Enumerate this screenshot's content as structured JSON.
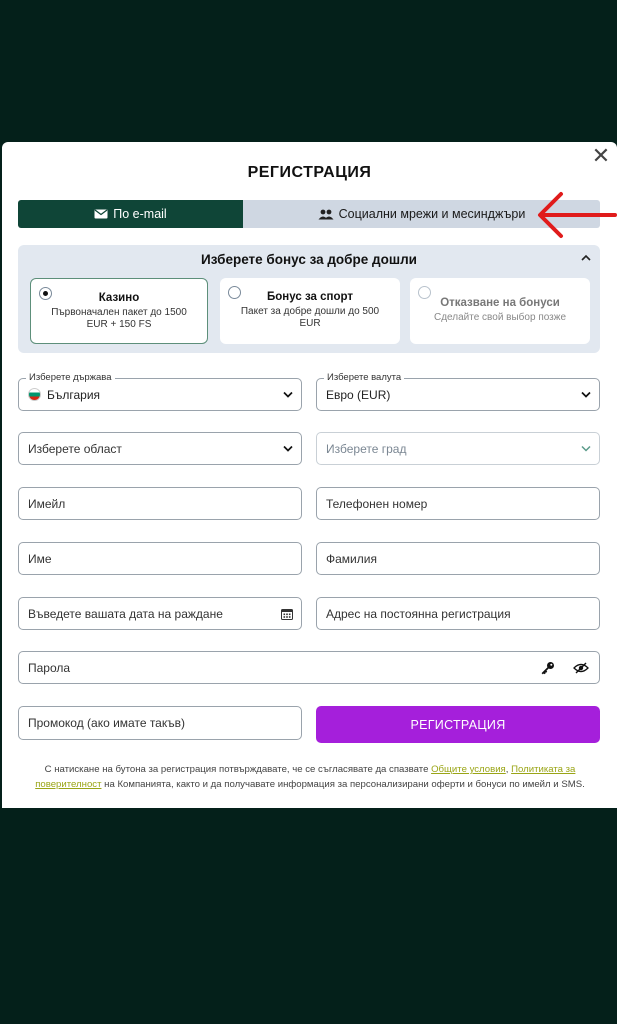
{
  "modal": {
    "title": "РЕГИСТРАЦИЯ",
    "close_symbol": "✕"
  },
  "tabs": [
    {
      "label": "По e-mail",
      "icon": "envelope-icon",
      "active": true
    },
    {
      "label": "Социални мрежи и месинджъри",
      "icon": "users-icon",
      "active": false
    }
  ],
  "bonus": {
    "heading": "Изберете бонус за добре дошли",
    "options": [
      {
        "title": "Казино",
        "desc": "Първоначален пакет до 1500 EUR + 150 FS",
        "selected": true
      },
      {
        "title": "Бонус за спорт",
        "desc": "Пакет за добре дошли до 500 EUR",
        "selected": false
      },
      {
        "title": "Отказване на бонуси",
        "desc": "Сделайте свой выбор позже",
        "selected": false
      }
    ]
  },
  "form": {
    "country": {
      "legend": "Изберете държава",
      "value": "България"
    },
    "currency": {
      "legend": "Изберете валута",
      "value": "Евро (EUR)"
    },
    "region": {
      "placeholder": "Изберете област"
    },
    "city": {
      "placeholder": "Изберете град"
    },
    "email": {
      "placeholder": "Имейл"
    },
    "phone": {
      "placeholder": "Телефонен номер"
    },
    "first_name": {
      "placeholder": "Име"
    },
    "last_name": {
      "placeholder": "Фамилия"
    },
    "birthdate": {
      "placeholder": "Въведете вашата дата на раждане"
    },
    "address": {
      "placeholder": "Адрес на постоянна регистрация"
    },
    "password": {
      "placeholder": "Парола"
    },
    "promo": {
      "placeholder": "Промокод (ако имате такъв)"
    },
    "submit_label": "РЕГИСТРАЦИЯ"
  },
  "terms": {
    "text_1": "С натискане на бутона за регистрация потвърждавате, че се съгласявате да спазвате ",
    "link_1": "Общите условия",
    "text_2": ", ",
    "link_2": "Политиката за поверителност",
    "text_3": " на Компанията, както и да получавате информация за персонализирани оферти и бонуси по имейл и SMS."
  },
  "colors": {
    "background": "#04201a",
    "tab_active": "#0f4537",
    "tab_inactive": "#cfd7e2",
    "submit": "#a51fdb",
    "link": "#9aa516",
    "annotation_arrow": "#e01b1b"
  }
}
